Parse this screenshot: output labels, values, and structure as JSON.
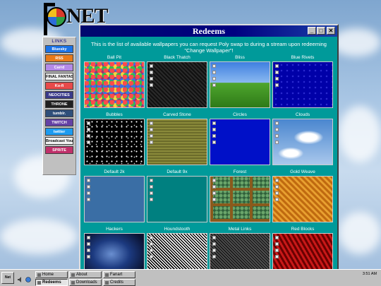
{
  "window": {
    "title": "Redeems",
    "description": "This is the list of available wallpapers you can request Poly swap to during a stream upon redeeming \"Change Wallpaper\"!",
    "controls": [
      "minimize",
      "maximize",
      "close"
    ]
  },
  "logo": {
    "text": "NET"
  },
  "links": {
    "title": "LINKS",
    "items": [
      {
        "label": "Bluesky",
        "color": "#1a73e8"
      },
      {
        "label": "RSS",
        "color": "#e87a1a"
      },
      {
        "label": "Carrd",
        "color": "#b48ae8"
      },
      {
        "label": "FINAL FANTASY XIV",
        "color": "#eeeeee"
      },
      {
        "label": "Ko-fi",
        "color": "#e84a4a"
      },
      {
        "label": "NEOCITIES",
        "color": "#3a3a8a"
      },
      {
        "label": "THRONE",
        "color": "#202020"
      },
      {
        "label": "tumblr.",
        "color": "#2f4f7a"
      },
      {
        "label": "TWITCH",
        "color": "#6441a5"
      },
      {
        "label": "twitter",
        "color": "#1d9bf0"
      },
      {
        "label": "Broadcast Yourself",
        "color": "#f4f4f4"
      },
      {
        "label": "SPRITE",
        "color": "#c0306a"
      }
    ]
  },
  "wallpapers": [
    {
      "name": "Ball Pit",
      "style": "ballpit",
      "icons": false
    },
    {
      "name": "Black Thatch",
      "style": "blackthatch",
      "icons": true
    },
    {
      "name": "Bliss",
      "style": "bliss",
      "icons": true
    },
    {
      "name": "Blue Rivets",
      "style": "bluerivets",
      "icons": true
    },
    {
      "name": "Bubbles",
      "style": "bubbles",
      "icons": true
    },
    {
      "name": "Carved Stone",
      "style": "carvedstone",
      "icons": true
    },
    {
      "name": "Circles",
      "style": "circles",
      "icons": true
    },
    {
      "name": "Clouds",
      "style": "clouds",
      "icons": true
    },
    {
      "name": "Default 2k",
      "style": "default2k",
      "icons": true
    },
    {
      "name": "Default 9x",
      "style": "default9x",
      "icons": true
    },
    {
      "name": "Forest",
      "style": "forest",
      "icons": true
    },
    {
      "name": "Gold Weave",
      "style": "goldweave",
      "icons": true
    },
    {
      "name": "Hackers",
      "style": "hackers",
      "icons": true
    },
    {
      "name": "Houndstooth",
      "style": "houndstooth",
      "icons": true
    },
    {
      "name": "Metal Links",
      "style": "metallinks",
      "icons": true
    },
    {
      "name": "Red Blocks",
      "style": "redblocks",
      "icons": true
    }
  ],
  "taskbar": {
    "start_label": "Net",
    "tasks": [
      {
        "label": "Home",
        "active": false
      },
      {
        "label": "About",
        "active": false
      },
      {
        "label": "Fanart",
        "active": false
      },
      {
        "label": "Redeems",
        "active": true
      },
      {
        "label": "Downloads",
        "active": false
      },
      {
        "label": "Credits",
        "active": false
      }
    ],
    "clock": "3:51 AM"
  }
}
